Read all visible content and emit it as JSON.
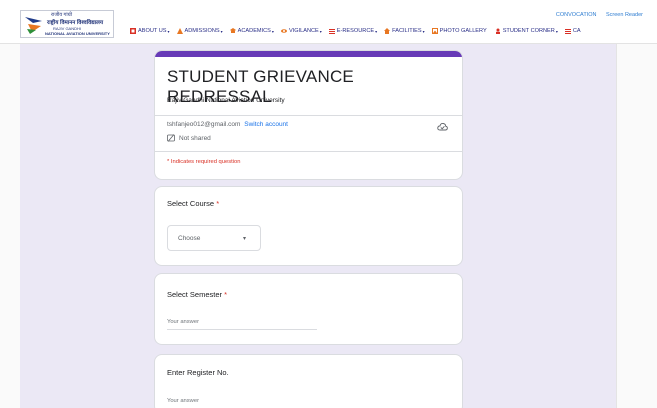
{
  "header": {
    "logo": {
      "line1": "राजीव गांधी",
      "line2": "राष्ट्रीय विमानन विश्वविद्यालय",
      "line3": "RAJIV GANDHI",
      "line4": "NATIONAL AVIATION UNIVERSITY"
    },
    "top_links": [
      "CONVOCATION",
      "Screen Reader"
    ],
    "nav": [
      {
        "label": "ABOUT US",
        "icon": "about-icon",
        "caret": "▾"
      },
      {
        "label": "ADMISSIONS",
        "icon": "admissions-icon",
        "caret": "▾"
      },
      {
        "label": "ACADEMICS",
        "icon": "academics-icon",
        "caret": "▾"
      },
      {
        "label": "VIGILANCE",
        "icon": "vigilance-icon",
        "caret": "▾"
      },
      {
        "label": "E-RESOURCE",
        "icon": "eresource-icon",
        "caret": "▾"
      },
      {
        "label": "FACILITIES",
        "icon": "facilities-icon",
        "caret": "▾"
      },
      {
        "label": "PHOTO GALLERY",
        "icon": "photo-gallery-icon",
        "caret": ""
      },
      {
        "label": "STUDENT CORNER",
        "icon": "student-corner-icon",
        "caret": "▾"
      },
      {
        "label": "CA",
        "icon": "careers-icon",
        "caret": ""
      }
    ]
  },
  "form": {
    "title": "STUDENT GRIEVANCE REDRESSAL",
    "subtitle": "Rajiv Gandhi National Aviation University",
    "account_email": "tshfanjeo012@gmail.com",
    "switch_account": "Switch account",
    "not_shared": "Not shared",
    "required_note": "* Indicates required question"
  },
  "questions": {
    "course": {
      "title": "Select Course",
      "required_mark": "*",
      "dropdown_value": "Choose",
      "dropdown_arrow": "▾"
    },
    "semester": {
      "title": "Select Semester",
      "required_mark": "*",
      "answer_placeholder": "Your answer"
    },
    "register": {
      "title": "Enter Register No.",
      "answer_placeholder": "Your answer"
    }
  },
  "colors": {
    "accent": "#673ab7",
    "page_bg": "#ebe8f5",
    "link": "#1a73e8",
    "required": "#d93025",
    "nav_text": "#2a2f87"
  }
}
